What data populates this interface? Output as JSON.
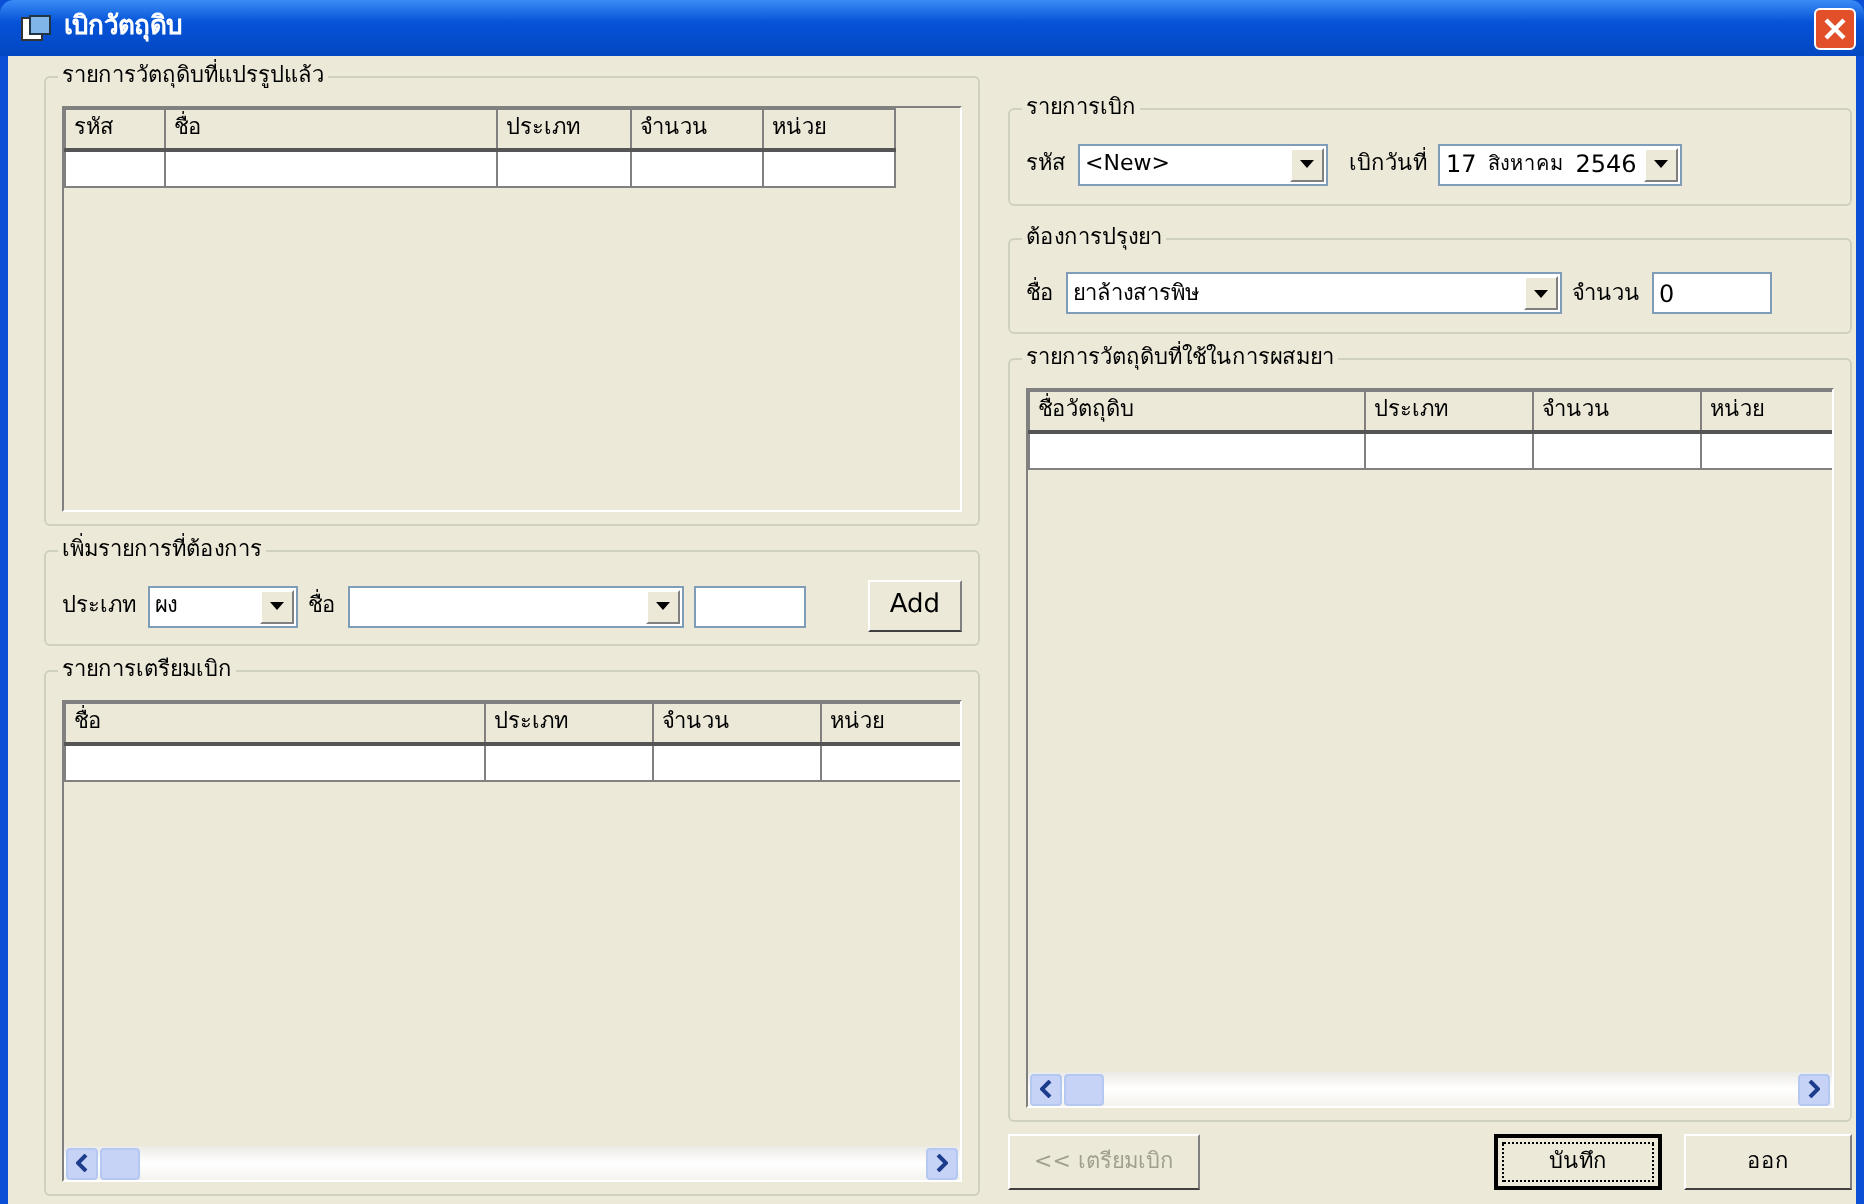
{
  "window": {
    "title": "เบิกวัตถุดิบ"
  },
  "processed_materials": {
    "title": "รายการวัตถุดิบที่แปรรูปแล้ว",
    "columns": [
      "รหัส",
      "ชื่อ",
      "ประเภท",
      "จำนวน",
      "หน่วย"
    ]
  },
  "add_item": {
    "title": "เพิ่มรายการที่ต้องการ",
    "type_label": "ประเภท",
    "type_value": "ผง",
    "name_label": "ชื่อ",
    "button": "Add"
  },
  "prepared_list": {
    "title": "รายการเตรียมเบิก",
    "columns": [
      "ชื่อ",
      "ประเภท",
      "จำนวน",
      "หน่วย"
    ]
  },
  "withdrawal": {
    "title": "รายการเบิก",
    "code_label": "รหัส",
    "code_value": "<New>",
    "date_label": "เบิกวันที่",
    "date": {
      "day": "17",
      "month": "สิงหาคม",
      "year": "2546"
    }
  },
  "recipe": {
    "title": "ต้องการปรุงยา",
    "name_label": "ชื่อ",
    "name_value": "ยาล้างสารพิษ",
    "quantity_label": "จำนวน",
    "quantity_value": "0"
  },
  "ingredients": {
    "title": "รายการวัตถุดิบที่ใช้ในการผสมยา",
    "columns": [
      "ชื่อวัตถุดิบ",
      "ประเภท",
      "จำนวน",
      "หน่วย"
    ]
  },
  "buttons": [
    {
      "label": "<< เตรียมเบิก",
      "disabled": true,
      "default": false
    },
    {
      "label": "บันทึก",
      "disabled": false,
      "default": true
    },
    {
      "label": "ออก",
      "disabled": false,
      "default": false
    }
  ]
}
